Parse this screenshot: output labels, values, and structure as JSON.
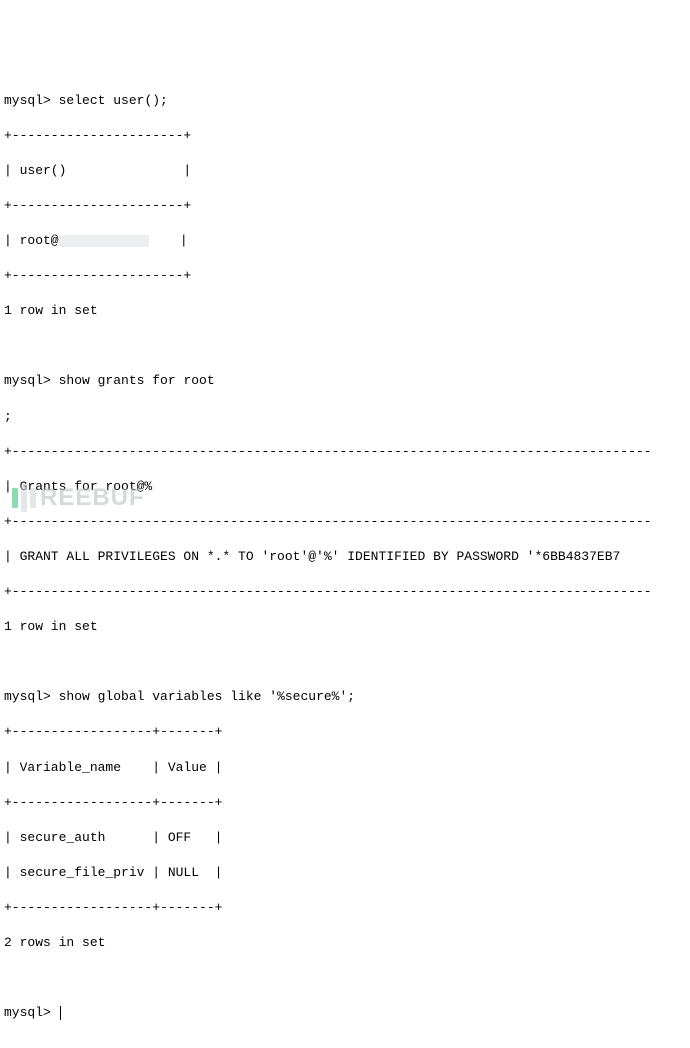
{
  "prompt": "mysql>",
  "block1": {
    "command": "select user();",
    "border": "+----------------------+",
    "header": "| user()               |",
    "row_prefix": "| root@",
    "row_suffix": "    |",
    "footer": "1 row in set"
  },
  "block2": {
    "command_line1": "show grants for root",
    "command_line2": ";",
    "long_border": "+----------------------------------------------------------------------------------",
    "header": "| Grants for root@%",
    "row": "| GRANT ALL PRIVILEGES ON *.* TO 'root'@'%' IDENTIFIED BY PASSWORD '*6BB4837EB7",
    "footer": "1 row in set"
  },
  "block3": {
    "command": "show global variables like '%secure%';",
    "border": "+------------------+-------+",
    "header": "| Variable_name    | Value |",
    "row1": "| secure_auth      | OFF   |",
    "row2": "| secure_file_priv | NULL  |",
    "footer": "2 rows in set"
  },
  "watermark": {
    "text": "REEBUF"
  }
}
